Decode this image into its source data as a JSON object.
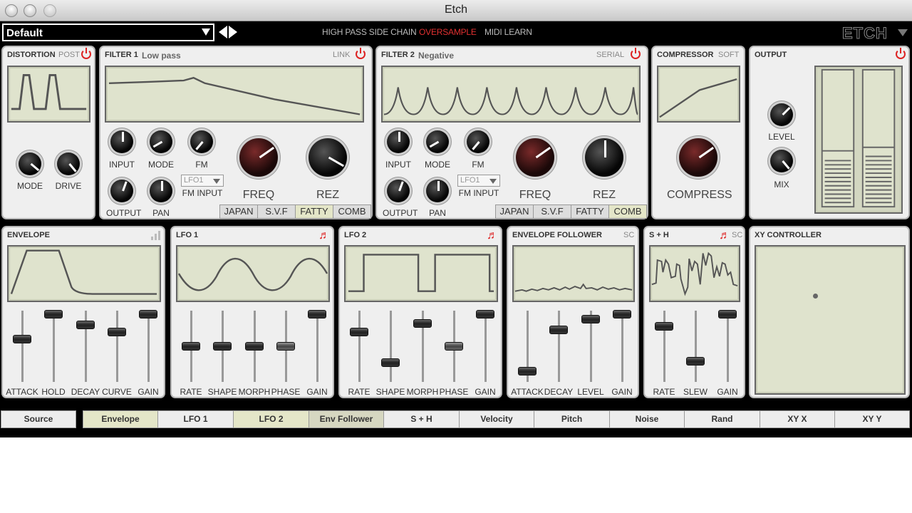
{
  "window": {
    "title": "Etch"
  },
  "topbar": {
    "preset": "Default",
    "buttons": [
      "HIGH PASS SIDE CHAIN",
      "OVERSAMPLE",
      "MIDI LEARN"
    ],
    "active_button": "OVERSAMPLE",
    "logo": "ETCH"
  },
  "distortion": {
    "title": "DISTORTION",
    "tag": "POST",
    "knobs": [
      "MODE",
      "DRIVE"
    ]
  },
  "filter1": {
    "title": "FILTER 1",
    "subtitle": "Low pass",
    "tag": "LINK",
    "small_knobs": [
      "INPUT",
      "MODE",
      "FM",
      "OUTPUT",
      "PAN"
    ],
    "fm_input_value": "LFO1",
    "fm_input_label": "FM INPUT",
    "big_knobs": [
      "FREQ",
      "REZ"
    ],
    "modes": [
      "JAPAN",
      "S.V.F",
      "FATTY",
      "COMB"
    ],
    "active_mode": "FATTY"
  },
  "filter2": {
    "title": "FILTER 2",
    "subtitle": "Negative",
    "tag": "SERIAL",
    "small_knobs": [
      "INPUT",
      "MODE",
      "FM",
      "OUTPUT",
      "PAN"
    ],
    "fm_input_value": "LFO1",
    "fm_input_label": "FM INPUT",
    "big_knobs": [
      "FREQ",
      "REZ"
    ],
    "modes": [
      "JAPAN",
      "S.V.F",
      "FATTY",
      "COMB"
    ],
    "active_mode": "COMB"
  },
  "compressor": {
    "title": "COMPRESSOR",
    "tag": "SOFT",
    "knob": "COMPRESS"
  },
  "output": {
    "title": "OUTPUT",
    "knobs": [
      "LEVEL",
      "MIX"
    ],
    "meter_levels": [
      0.35,
      0.35
    ]
  },
  "envelope": {
    "title": "ENVELOPE",
    "sliders": [
      {
        "label": "ATTACK",
        "value": 0.6
      },
      {
        "label": "HOLD",
        "value": 0.95
      },
      {
        "label": "DECAY",
        "value": 0.8
      },
      {
        "label": "CURVE",
        "value": 0.7
      },
      {
        "label": "GAIN",
        "value": 0.95
      }
    ]
  },
  "lfo1": {
    "title": "LFO 1",
    "sliders": [
      {
        "label": "RATE",
        "value": 0.5
      },
      {
        "label": "SHAPE",
        "value": 0.5
      },
      {
        "label": "MORPH",
        "value": 0.5
      },
      {
        "label": "PHASE",
        "value": 0.5
      },
      {
        "label": "GAIN",
        "value": 0.95
      }
    ]
  },
  "lfo2": {
    "title": "LFO 2",
    "sliders": [
      {
        "label": "RATE",
        "value": 0.7
      },
      {
        "label": "SHAPE",
        "value": 0.27
      },
      {
        "label": "MORPH",
        "value": 0.82
      },
      {
        "label": "PHASE",
        "value": 0.5
      },
      {
        "label": "GAIN",
        "value": 0.95
      }
    ]
  },
  "envfollower": {
    "title": "ENVELOPE FOLLOWER",
    "tag": "SC",
    "sliders": [
      {
        "label": "ATTACK",
        "value": 0.15
      },
      {
        "label": "DECAY",
        "value": 0.73
      },
      {
        "label": "LEVEL",
        "value": 0.88
      },
      {
        "label": "GAIN",
        "value": 0.95
      }
    ]
  },
  "sh": {
    "title": "S + H",
    "tag": "SC",
    "sliders": [
      {
        "label": "RATE",
        "value": 0.78
      },
      {
        "label": "SLEW",
        "value": 0.29
      },
      {
        "label": "GAIN",
        "value": 0.95
      }
    ]
  },
  "xy": {
    "title": "XY CONTROLLER"
  },
  "sources": [
    "Source",
    "Envelope",
    "LFO 1",
    "LFO 2",
    "Env Follower",
    "S + H",
    "Velocity",
    "Pitch",
    "Noise",
    "Rand",
    "XY X",
    "XY Y"
  ],
  "active_sources": [
    "Envelope",
    "LFO 2",
    "Env Follower"
  ]
}
